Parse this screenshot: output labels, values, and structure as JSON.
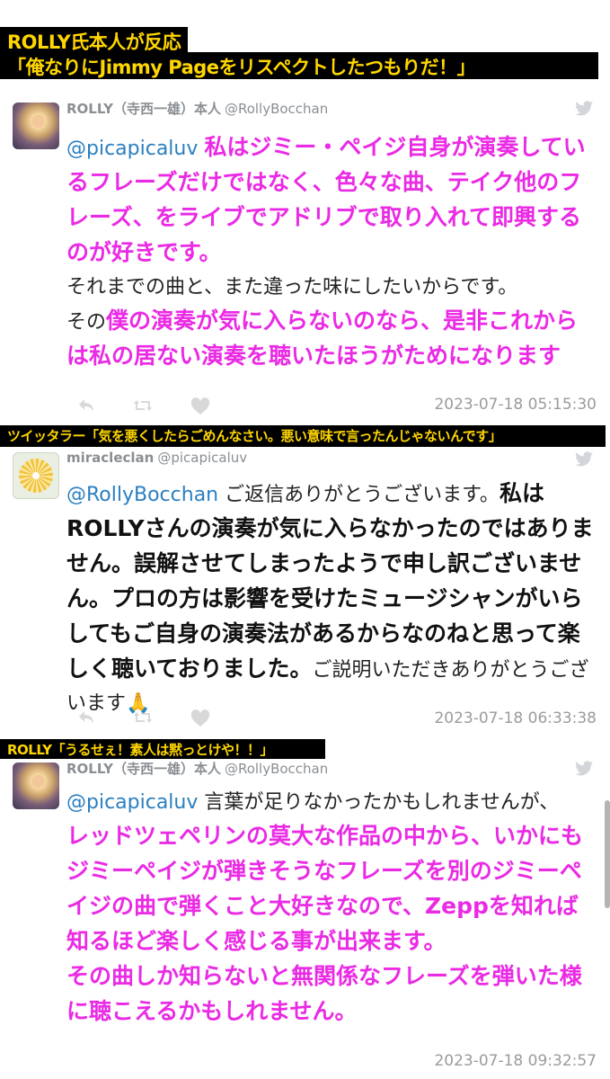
{
  "banners": {
    "top_line1": "ROLLY氏本人が反応",
    "top_line2": "「俺なりにJimmy Pageをリスペクトしたつもりだ！」",
    "middle": "ツイッタラー「気を悪くしたらごめんなさい。悪い意味で言ったんじゃないんです」",
    "bottom": "ROLLY「うるせぇ！素人は黙っとけや！！」"
  },
  "tweets": [
    {
      "name": "ROLLY（寺西一雄）本人",
      "handle": "@RollyBocchan",
      "avatar": "rolly-avatar",
      "mention": "@picapicaluv",
      "text_pink_1": "私はジミー・ペイジ自身が演奏しているフレーズだけではなく、色々な曲、テイク他のフレーズ、をライブでアドリブで取り入れて即興するのが好きです。",
      "text_plain_1": "それまでの曲と、また違った味にしたいからです。",
      "text_plain_2": "その",
      "text_pink_2": "僕の演奏が気に入らないのなら、是非これからは私の居ない演奏を聴いたほうがためになります",
      "timestamp": "2023-07-18 05:15:30"
    },
    {
      "name": "miracleclan",
      "handle": "@picapicaluv",
      "avatar": "miracleclan-avatar",
      "mention": "@RollyBocchan",
      "text_plain_1": "ご返信ありがとうございます。",
      "text_bold_1": "私はROLLYさんの演奏が気に入らなかったのではありません。誤解させてしまったようで申し訳ございません。プロの方は影響を受けたミュージシャンがいらしてもご自身の演奏法があるからなのねと思って楽しく聴いておりました。",
      "text_plain_2": "ご説明いただきありがとうございます🙏",
      "timestamp": "2023-07-18 06:33:38"
    },
    {
      "name": "ROLLY（寺西一雄）本人",
      "handle": "@RollyBocchan",
      "avatar": "rolly-avatar",
      "mention": "@picapicaluv",
      "text_plain_1": "言葉が足りなかったかもしれませんが、",
      "text_pink_1": "レッドツェペリンの莫大な作品の中から、いかにもジミーペイジが弾きそうなフレーズを別のジミーペイジの曲で弾くこと大好きなので、Zeppを知れば知るほど楽しく感じる事が出来ます。",
      "text_pink_2": "その曲しか知らないと無関係なフレーズを弾いた様に聴こえるかもしれません。",
      "timestamp": "2023-07-18 09:32:57"
    }
  ],
  "icons": [
    "reply-icon",
    "retweet-icon",
    "like-icon",
    "twitter-bird-icon"
  ],
  "colors": {
    "pink": "#ea2ae4",
    "mention": "#2a7fc0",
    "banner_bg": "#000000",
    "banner_text": "#ffd600"
  }
}
